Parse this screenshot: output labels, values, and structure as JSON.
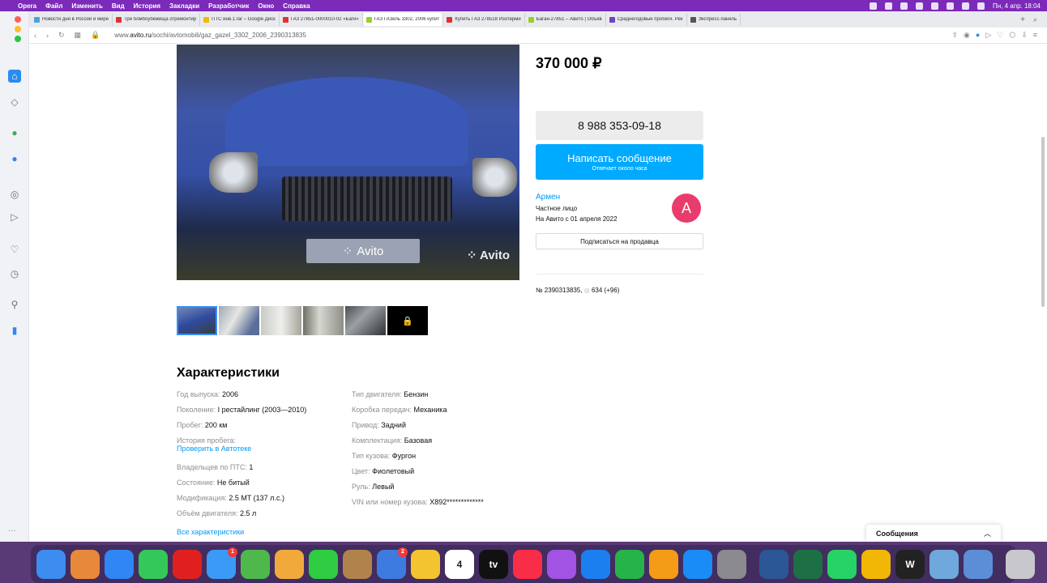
{
  "menubar": {
    "app": "Opera",
    "items": [
      "Файл",
      "Изменить",
      "Вид",
      "История",
      "Закладки",
      "Разработчик",
      "Окно",
      "Справка"
    ],
    "clock": "Пн, 4 апр. 18:04"
  },
  "tabs": [
    {
      "label": "Новости дня в России и мире",
      "color": "#4aa2e0"
    },
    {
      "label": "Три бомбоубежища отремонтир",
      "color": "#e03131"
    },
    {
      "label": "ПТС инв.1.rar – Google Диск",
      "color": "#f2b705"
    },
    {
      "label": "ГАЗ 27851-0000010-02 «Баги»",
      "color": "#e03131"
    },
    {
      "label": "ГАЗ ГАЗель 3302, 2006 купит",
      "color": "#97cf26",
      "active": true
    },
    {
      "label": "Купить ГАЗ 278518 Изотерми",
      "color": "#e03131"
    },
    {
      "label": "Баган-27851 – Авито | Объяв",
      "color": "#97cf26"
    },
    {
      "label": "Среднегодовые пробеги. Рек",
      "color": "#6f42c1"
    },
    {
      "label": "Экспресс-панель",
      "color": "#555"
    }
  ],
  "address": {
    "prefix": "www.",
    "domain": "avito.ru",
    "path": "/sochi/avtomobili/gaz_gazel_3302_2006_2390313835"
  },
  "listing": {
    "price": "370 000 ₽",
    "phone": "8 988 353-09-18",
    "message_button": "Написать сообщение",
    "message_sub": "Отвечает около часа",
    "photo_watermark": "Avito",
    "plate_text": "Avito",
    "lock_icon": "🔒"
  },
  "seller": {
    "name": "Армен",
    "type": "Частное лицо",
    "since": "На Авито с 01 апреля 2022",
    "avatar_letter": "A",
    "subscribe": "Подписаться на продавца"
  },
  "meta": {
    "number": "№ 2390313835,",
    "views": "634 (+96)"
  },
  "specs": {
    "title": "Характеристики",
    "left": [
      {
        "k": "Год выпуска: ",
        "v": "2006"
      },
      {
        "k": "Поколение: ",
        "v": "I рестайлинг (2003—2010)"
      },
      {
        "k": "Пробег: ",
        "v": "200 км"
      },
      {
        "k": "История пробега:",
        "v": "",
        "link": "Проверить в Автотеке"
      },
      {
        "k": "Владельцев по ПТС: ",
        "v": "1"
      },
      {
        "k": "Состояние: ",
        "v": "Не битый"
      },
      {
        "k": "Модификация: ",
        "v": "2.5 MT (137 л.с.)"
      },
      {
        "k": "Объём двигателя: ",
        "v": "2.5 л"
      }
    ],
    "right": [
      {
        "k": "Тип двигателя: ",
        "v": "Бензин"
      },
      {
        "k": "Коробка передач: ",
        "v": "Механика"
      },
      {
        "k": "Привод: ",
        "v": "Задний"
      },
      {
        "k": "Комплектация: ",
        "v": "Базовая"
      },
      {
        "k": "Тип кузова: ",
        "v": "Фургон"
      },
      {
        "k": "Цвет: ",
        "v": "Фиолетовый"
      },
      {
        "k": "Руль: ",
        "v": "Левый"
      },
      {
        "k": "VIN или номер кузова: ",
        "v": "X892*************"
      }
    ],
    "all_link": "Все характеристики"
  },
  "messages_panel": {
    "label": "Сообщения"
  },
  "dock": [
    {
      "name": "finder",
      "color": "#3d8cf0"
    },
    {
      "name": "launchpad",
      "color": "#e8883a"
    },
    {
      "name": "safari",
      "color": "#2f86f4"
    },
    {
      "name": "messages",
      "color": "#34c759"
    },
    {
      "name": "opera",
      "color": "#e0201f"
    },
    {
      "name": "mail",
      "color": "#3a9af5",
      "badge": "1"
    },
    {
      "name": "maps",
      "color": "#4fb84c"
    },
    {
      "name": "photos",
      "color": "#f2a93b"
    },
    {
      "name": "facetime",
      "color": "#2ecc40"
    },
    {
      "name": "contacts",
      "color": "#b0834d"
    },
    {
      "name": "reminders",
      "color": "#3e7be0",
      "badge": "2"
    },
    {
      "name": "notes",
      "color": "#f4c430"
    },
    {
      "name": "calendar",
      "color": "#ffffff",
      "text": "4"
    },
    {
      "name": "tv",
      "color": "#111111",
      "text": "tv"
    },
    {
      "name": "music",
      "color": "#fa2d48"
    },
    {
      "name": "podcasts",
      "color": "#a153e3"
    },
    {
      "name": "keynote",
      "color": "#1b7ff0"
    },
    {
      "name": "numbers",
      "color": "#25b34a"
    },
    {
      "name": "pages",
      "color": "#f49b18"
    },
    {
      "name": "app-store",
      "color": "#1a8cf7"
    },
    {
      "name": "system-preferences",
      "color": "#8a8a8f"
    },
    {
      "name": "word",
      "color": "#2b5797"
    },
    {
      "name": "excel",
      "color": "#1d7044"
    },
    {
      "name": "whatsapp",
      "color": "#25d366"
    },
    {
      "name": "chrome",
      "color": "#f2b705"
    },
    {
      "name": "w-app",
      "color": "#222222",
      "text": "W"
    },
    {
      "name": "preview",
      "color": "#6fa8dc"
    },
    {
      "name": "screenshots",
      "color": "#5b8ed6"
    },
    {
      "name": "trash",
      "color": "#c7c7cc"
    }
  ]
}
